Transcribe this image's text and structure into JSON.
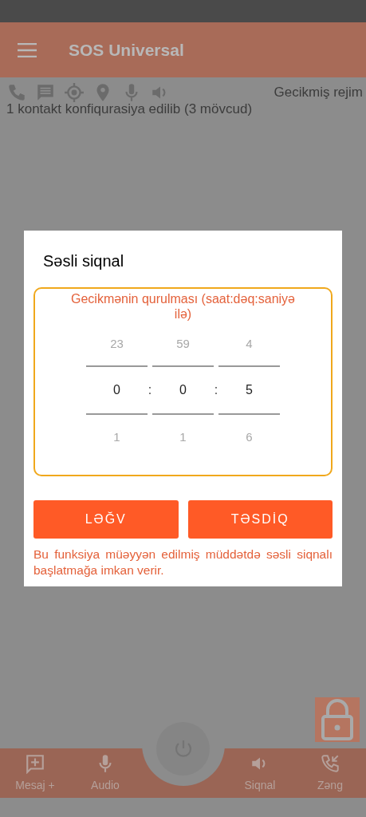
{
  "app_bar": {
    "title": "SOS Universal"
  },
  "status_row": {
    "mode": "Gecikmiş rejim",
    "contacts": "1 kontakt konfiqurasiya edilib (3 mövcud)"
  },
  "dialog": {
    "title": "Səsli siqnal",
    "picker": {
      "label": "Gecikmənin qurulması (saat:dəq:saniyə ilə)",
      "columns": [
        {
          "above": "23",
          "value": "0",
          "below": "1"
        },
        {
          "above": "59",
          "value": "0",
          "below": "1"
        },
        {
          "above": "4",
          "value": "5",
          "below": "6"
        }
      ],
      "separators": [
        ":",
        ":"
      ]
    },
    "buttons": [
      "LƏĞV",
      "TƏSDİQ"
    ],
    "note": "Bu funksiya müəyyən edilmiş müddətdə səsli siqnalı başlatmağa imkan verir."
  },
  "bottom_nav": [
    {
      "kind": "message-add",
      "label": "Mesaj +"
    },
    {
      "kind": "mic",
      "label": "Audio"
    },
    {
      "kind": "speaker",
      "label": "Siqnal"
    },
    {
      "kind": "call",
      "label": "Zəng"
    }
  ]
}
